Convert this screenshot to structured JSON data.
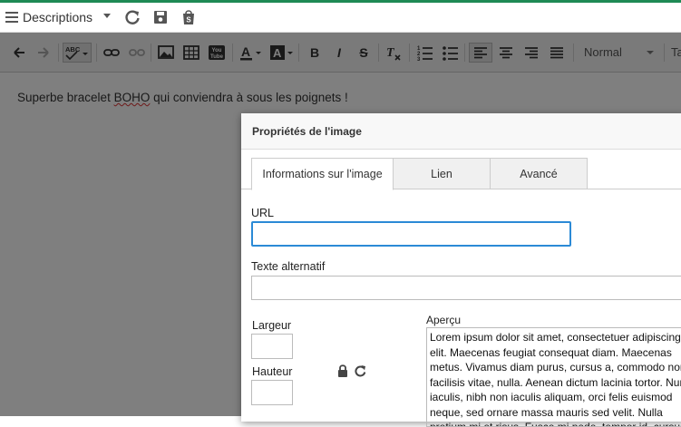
{
  "header": {
    "title": "Descriptions"
  },
  "toolbar": {
    "format_select": "Normal",
    "extra_label": "Ta"
  },
  "editor": {
    "text_before": "Superbe bracelet ",
    "text_spell": "BOHO",
    "text_after": " qui conviendra à sous les poignets !"
  },
  "dialog": {
    "title": "Propriétés de l'image",
    "tabs": [
      {
        "label": "Informations sur l'image"
      },
      {
        "label": "Lien"
      },
      {
        "label": "Avancé"
      }
    ],
    "url_label": "URL",
    "url_value": "",
    "alt_label": "Texte alternatif",
    "alt_value": "",
    "width_label": "Largeur",
    "height_label": "Hauteur",
    "preview_label": "Aperçu",
    "preview_text": "Lorem ipsum dolor sit amet, consectetuer adipiscing elit. Maecenas feugiat consequat diam. Maecenas metus. Vivamus diam purus, cursus a, commodo non, facilisis vitae, nulla. Aenean dictum lacinia tortor. Nunc iaculis, nibh non iaculis aliquam, orci felis euismod neque, sed ornare massa mauris sed velit. Nulla pretium mi et risus. Fusce mi pede, tempor id, cursus ac."
  },
  "colors": {
    "accent": "#1f8a55",
    "focus": "#2b8ad6"
  }
}
